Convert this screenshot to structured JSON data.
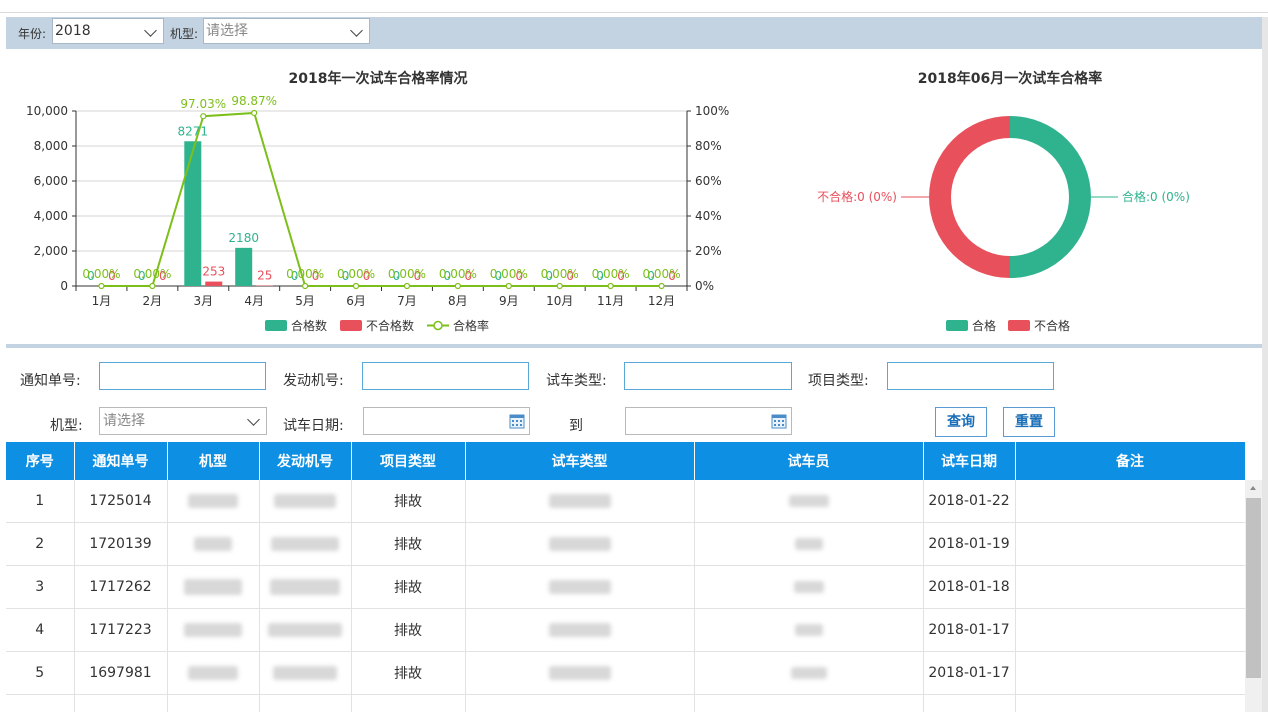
{
  "filters": {
    "year_label": "年份:",
    "year_value": "2018",
    "model_label": "机型:",
    "model_placeholder": "请选择"
  },
  "bar_chart": {
    "title": "2018年一次试车合格率情况",
    "legend": [
      "合格数",
      "不合格数",
      "合格率"
    ]
  },
  "donut_chart": {
    "title": "2018年06月一次试车合格率",
    "label_pass": "合格:0 (0%)",
    "label_fail": "不合格:0 (0%)",
    "legend": [
      "合格",
      "不合格"
    ]
  },
  "chart_data": [
    {
      "type": "bar",
      "title": "2018年一次试车合格率情况",
      "categories": [
        "1月",
        "2月",
        "3月",
        "4月",
        "5月",
        "6月",
        "7月",
        "8月",
        "9月",
        "10月",
        "11月",
        "12月"
      ],
      "series": [
        {
          "name": "合格数",
          "type": "bar",
          "axis": "left",
          "color": "#2fb38f",
          "values": [
            0,
            0,
            8271,
            2180,
            0,
            0,
            0,
            0,
            0,
            0,
            0,
            0
          ]
        },
        {
          "name": "不合格数",
          "type": "bar",
          "axis": "left",
          "color": "#e8505b",
          "values": [
            0,
            0,
            253,
            25,
            0,
            0,
            0,
            0,
            0,
            0,
            0,
            0
          ]
        },
        {
          "name": "合格率",
          "type": "line",
          "axis": "right",
          "color": "#7dbf1a",
          "values": [
            0,
            0,
            97.03,
            98.87,
            0,
            0,
            0,
            0,
            0,
            0,
            0,
            0
          ],
          "labels": [
            "0.00%",
            "0.00%",
            "97.03%",
            "98.87%",
            "0.00%",
            "0.00%",
            "0.00%",
            "0.00%",
            "0.00%",
            "0.00%",
            "0.00%",
            "0.00%"
          ]
        }
      ],
      "yticks_left": [
        "0",
        "2,000",
        "4,000",
        "6,000",
        "8,000",
        "10,000"
      ],
      "ylim_left": [
        0,
        10000
      ],
      "yticks_right": [
        "0%",
        "20%",
        "40%",
        "60%",
        "80%",
        "100%"
      ],
      "ylim_right": [
        0,
        100
      ],
      "grid": true,
      "legend_position": "bottom"
    },
    {
      "type": "pie",
      "title": "2018年06月一次试车合格率",
      "labels": [
        "合格",
        "不合格"
      ],
      "values": [
        0,
        0
      ],
      "colors": [
        "#2fb38f",
        "#e8505b"
      ],
      "legend_position": "bottom"
    }
  ],
  "search": {
    "notice_no_label": "通知单号:",
    "engine_no_label": "发动机号:",
    "test_type_label": "试车类型:",
    "item_type_label": "项目类型:",
    "model_label": "机型:",
    "model_placeholder": "请选择",
    "date_label": "试车日期:",
    "to_label": "到",
    "query_button": "查询",
    "reset_button": "重置"
  },
  "table": {
    "headers": [
      "序号",
      "通知单号",
      "机型",
      "发动机号",
      "项目类型",
      "试车类型",
      "试车员",
      "试车日期",
      "备注"
    ],
    "rows": [
      {
        "seq": "1",
        "notice": "1725014",
        "item_type": "排故",
        "date": "2018-01-22"
      },
      {
        "seq": "2",
        "notice": "1720139",
        "item_type": "排故",
        "date": "2018-01-19"
      },
      {
        "seq": "3",
        "notice": "1717262",
        "item_type": "排故",
        "date": "2018-01-18"
      },
      {
        "seq": "4",
        "notice": "1717223",
        "item_type": "排故",
        "date": "2018-01-17"
      },
      {
        "seq": "5",
        "notice": "1697981",
        "item_type": "排故",
        "date": "2018-01-17"
      }
    ]
  }
}
